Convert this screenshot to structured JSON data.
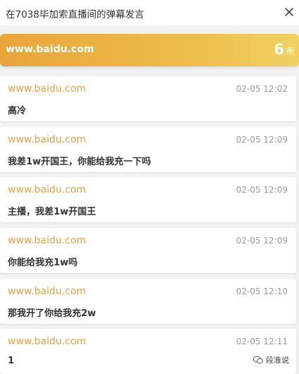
{
  "header": {
    "title": "在7038毕加索直播间的弹幕发言",
    "close_icon": "close-icon"
  },
  "summary": {
    "site": "www.baidu.com",
    "count": "6",
    "unit": "条"
  },
  "messages": [
    {
      "site": "www.baidu.com",
      "time": "02-05 12:02",
      "text": "高冷"
    },
    {
      "site": "www.baidu.com",
      "time": "02-05 12:09",
      "text": "我差1w开国王，你能给我充一下吗"
    },
    {
      "site": "www.baidu.com",
      "time": "02-05 12:09",
      "text": "主播，我差1w开国王"
    },
    {
      "site": "www.baidu.com",
      "time": "02-05 12:09",
      "text": "你能给我充1w吗"
    },
    {
      "site": "www.baidu.com",
      "time": "02-05 12:10",
      "text": "那我开了你给我充2w"
    },
    {
      "site": "www.baidu.com",
      "time": "02-05 12:11",
      "text": "1"
    }
  ],
  "watermark": {
    "text": "段准说",
    "icon": "wechat-icon"
  },
  "colors": {
    "accent": "#e7a049",
    "banner_start": "#e9a53a",
    "banner_end": "#f0d160"
  }
}
